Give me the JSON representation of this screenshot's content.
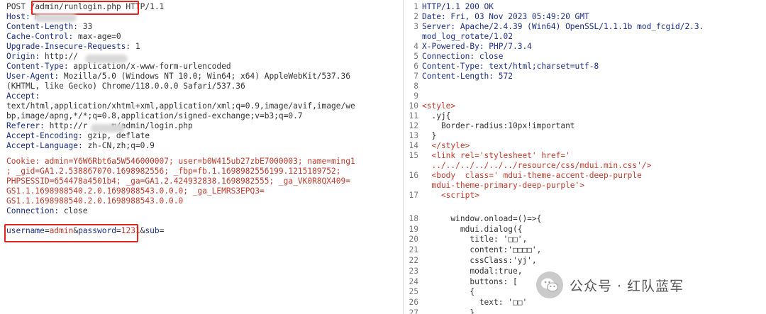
{
  "request": {
    "request_line": {
      "method": "POST ",
      "path": "/admin/runlogin.php",
      "version": " HTTP/1.1"
    },
    "headers": [
      {
        "name": "Host:",
        "value": " m"
      },
      {
        "name": "Content-Length:",
        "value": " 33"
      },
      {
        "name": "Cache-Control:",
        "value": " max-age=0"
      },
      {
        "name": "Upgrade-Insecure-Requests:",
        "value": " 1"
      },
      {
        "name": "Origin:",
        "value": " http://"
      },
      {
        "name": "Content-Type:",
        "value": " application/x-www-form-urlencoded"
      },
      {
        "name": "User-Agent:",
        "value": " Mozilla/5.0 (Windows NT 10.0; Win64; x64) AppleWebKit/537.36"
      },
      {
        "name": "",
        "value": "(KHTML, like Gecko) Chrome/118.0.0.0 Safari/537.36"
      },
      {
        "name": "Accept:",
        "value": ""
      },
      {
        "name": "",
        "value": "text/html,application/xhtml+xml,application/xml;q=0.9,image/avif,image/we"
      },
      {
        "name": "",
        "value": "bp,image/apng,*/*;q=0.8,application/signed-exchange;v=b3;q=0.7"
      },
      {
        "name": "Referer:",
        "value": " http://r     m/admin/login.php"
      },
      {
        "name": "Accept-Encoding:",
        "value": " gzip, deflate"
      },
      {
        "name": "Accept-Language:",
        "value": " zh-CN,zh;q=0.9"
      }
    ],
    "cookie_lines": [
      "Cookie: admin=Y6W6Rbt6a5W546000007; user=b0W415ub27zbE7000003; name=ming1",
      "; _gid=GA1.2.538867070.1698982556; _fbp=fb.1.1698982556199.1215189752;",
      "PHPSESSID=654478a4501b4; _ga=GA1.2.424932838.1698982555; _ga_VK0R8QX409=",
      "GS1.1.1698988540.2.0.1698988543.0.0.0; _ga_LEMRS3EPQ3=",
      "GS1.1.1698988540.2.0.1698988543.0.0.0"
    ],
    "connection": {
      "name": "Connection:",
      "value": " close"
    },
    "body": {
      "user_key": "username",
      "user_val": "admin",
      "pass_key": "password",
      "pass_val": "1231",
      "sub_key": "sub",
      "sub_val": ""
    }
  },
  "response": {
    "lines": [
      {
        "n": "1",
        "text": "HTTP/1.1 200 OK"
      },
      {
        "n": "2",
        "text": "Date: Fri, 03 Nov 2023 05:49:20 GMT"
      },
      {
        "n": "3",
        "text": "Server: Apache/2.4.39 (Win64) OpenSSL/1.1.1b mod_fcgid/2.3."
      },
      {
        "n": "",
        "text": "mod_log_rotate/1.02"
      },
      {
        "n": "4",
        "text": "X-Powered-By: PHP/7.3.4"
      },
      {
        "n": "5",
        "text": "Connection: close"
      },
      {
        "n": "6",
        "text": "Content-Type: text/html;charset=utf-8"
      },
      {
        "n": "7",
        "text": "Content-Length: 572"
      },
      {
        "n": "8",
        "text": ""
      },
      {
        "n": "9",
        "text": ""
      },
      {
        "n": "10",
        "text": "<style>"
      },
      {
        "n": "11",
        "text": "  .yj{"
      },
      {
        "n": "12",
        "text": "    Border-radius:10px!important"
      },
      {
        "n": "13",
        "text": "  }"
      },
      {
        "n": "14",
        "text": "  </style>"
      },
      {
        "n": "15",
        "text": "  <link rel='stylesheet' href='"
      },
      {
        "n": "",
        "text": "  ../../../../../../resource/css/mdui.min.css'/>"
      },
      {
        "n": "16",
        "text": "  <body  class=' mdui-theme-accent-deep-purple"
      },
      {
        "n": "",
        "text": "  mdui-theme-primary-deep-purple'>"
      },
      {
        "n": "17",
        "text": "    <script>"
      },
      {
        "n": "",
        "text": ""
      },
      {
        "n": "18",
        "text": "      window.onload=()=>{"
      },
      {
        "n": "19",
        "text": "        mdui.dialog({"
      },
      {
        "n": "20",
        "text": "          title: '□□',"
      },
      {
        "n": "21",
        "text": "          content:'□□□□',"
      },
      {
        "n": "22",
        "text": "          cssClass:'yj',"
      },
      {
        "n": "23",
        "text": "          modal:true,"
      },
      {
        "n": "24",
        "text": "          buttons: ["
      },
      {
        "n": "25",
        "text": "          {"
      },
      {
        "n": "26",
        "text": "            text: '□□'"
      },
      {
        "n": "27",
        "text": "          }"
      }
    ]
  },
  "watermark": {
    "text": "公众号 · 红队蓝军",
    "icon": "wechat-icon"
  }
}
